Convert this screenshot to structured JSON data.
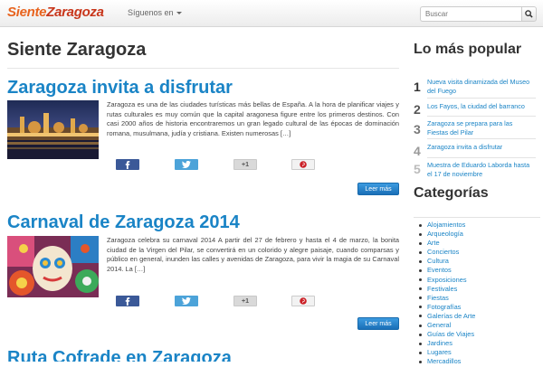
{
  "navbar": {
    "brand_part1": "Siente",
    "brand_part2": "Zaragoza",
    "follow_label": "Síguenos en",
    "search_placeholder": "Buscar"
  },
  "main": {
    "title": "Siente Zaragoza",
    "posts": [
      {
        "title": "Zaragoza invita a disfrutar",
        "excerpt": "Zaragoza es una de las ciudades turísticas más bellas de España. A la hora de planificar viajes y rutas culturales es muy común que la capital aragonesa figure entre los primeros destinos. Con casi 2000 años de historia encontraremos un gran legado cultural de las épocas de dominación romana, musulmana, judía y cristiana. Existen numerosas […]",
        "gplus_label": "+1",
        "read_more": "Leer más"
      },
      {
        "title": "Carnaval de Zaragoza 2014",
        "excerpt": "Zaragoza celebra su carnaval 2014 A partir del 27 de febrero y hasta el 4 de marzo, la bonita ciudad de la Virgen del Pilar, se convertirá en un colorido y alegre paisaje, cuando comparsas y público en general, inunden las calles y avenidas de Zaragoza, para vivir la magia de su Carnaval 2014.  La […]",
        "gplus_label": "+1",
        "read_more": "Leer más"
      },
      {
        "title": "Ruta Cofrade en Zaragoza"
      }
    ]
  },
  "sidebar": {
    "popular_title": "Lo más popular",
    "popular": [
      {
        "num": "1",
        "text": "Nueva visita dinamizada del Museo del Fuego"
      },
      {
        "num": "2",
        "text": "Los Fayos, la ciudad del barranco"
      },
      {
        "num": "3",
        "text": "Zaragoza se prepara para las Fiestas del Pilar"
      },
      {
        "num": "4",
        "text": "Zaragoza invita a disfrutar"
      },
      {
        "num": "5",
        "text": "Muestra de Eduardo Laborda hasta el 17 de noviembre"
      }
    ],
    "categories_title": "Categorías",
    "categories": [
      "Alojamientos",
      "Arqueología",
      "Arte",
      "Conciertos",
      "Cultura",
      "Eventos",
      "Exposiciones",
      "Festivales",
      "Fiestas",
      "Fotografías",
      "Galerías de Arte",
      "General",
      "Guías de Viajes",
      "Jardines",
      "Lugares",
      "Mercadillos"
    ]
  },
  "colors": {
    "accent_blue": "#1a84c6",
    "brand_orange": "#e8641f",
    "brand_red": "#c8361b",
    "facebook": "#3b5998",
    "twitter": "#4ca3d9"
  },
  "icons": [
    "chevron-down-icon",
    "search-icon",
    "facebook-icon",
    "twitter-icon",
    "google-plus-icon",
    "pinterest-icon"
  ]
}
